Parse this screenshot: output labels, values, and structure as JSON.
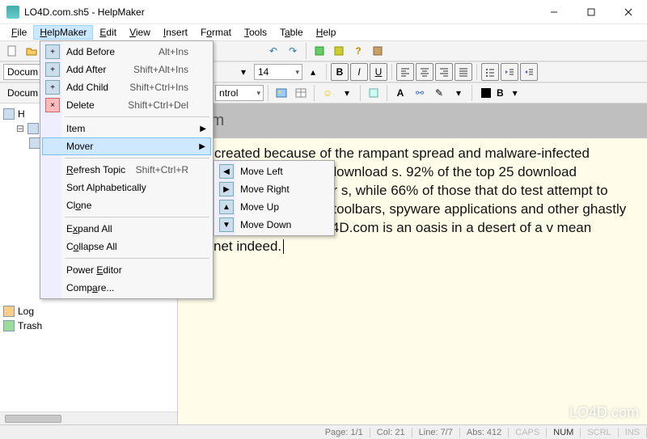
{
  "window": {
    "title": "LO4D.com.sh5 - HelpMaker"
  },
  "menubar": {
    "file": "File",
    "helpmaker": "HelpMaker",
    "edit": "Edit",
    "view": "View",
    "insert": "Insert",
    "format": "Format",
    "tools": "Tools",
    "table": "Table",
    "help": "Help"
  },
  "toolbar2": {
    "fontsize": "14",
    "bold": "B",
    "italic": "I",
    "underline": "U"
  },
  "toolbar3": {
    "combo_label": "ntrol",
    "color_label": "B"
  },
  "sidebar": {
    "tab": "Docum",
    "header": "Docum",
    "items": {
      "root_trunc": "H",
      "log": "Log",
      "trash": "Trash"
    }
  },
  "editor": {
    "heading_visible": ".com",
    "body_visible": "was created because of the rampant spread and malware-infected software on the largest download s. 92% of the top 25 download directories do not test for s, while 66% of those that do test attempt to infect your syst multiple toolbars, spyware applications and other ghastly ncements' anyways. LO4D.com is an oasis in a desert of a v mean Internet indeed."
  },
  "helpmaker_menu": {
    "add_before": {
      "label": "Add Before",
      "shortcut": "Alt+Ins"
    },
    "add_after": {
      "label": "Add After",
      "shortcut": "Shift+Alt+Ins"
    },
    "add_child": {
      "label": "Add Child",
      "shortcut": "Shift+Ctrl+Ins"
    },
    "delete": {
      "label": "Delete",
      "shortcut": "Shift+Ctrl+Del"
    },
    "item": {
      "label": "Item"
    },
    "mover": {
      "label": "Mover"
    },
    "refresh": {
      "label": "Refresh Topic",
      "shortcut": "Shift+Ctrl+R"
    },
    "sort": {
      "label": "Sort Alphabetically"
    },
    "clone": {
      "label": "Clone"
    },
    "expand_all": {
      "label": "Expand All"
    },
    "collapse_all": {
      "label": "Collapse All"
    },
    "power_editor": {
      "label": "Power Editor"
    },
    "compare": {
      "label": "Compare..."
    }
  },
  "mover_submenu": {
    "left": "Move Left",
    "right": "Move Right",
    "up": "Move Up",
    "down": "Move Down"
  },
  "status": {
    "page": "Page: 1/1",
    "col": "Col: 21",
    "line": "Line: 7/7",
    "abs": "Abs: 412",
    "caps": "CAPS",
    "num": "NUM",
    "scrl": "SCRL",
    "ins": "INS"
  },
  "watermark": "LO4D.com"
}
